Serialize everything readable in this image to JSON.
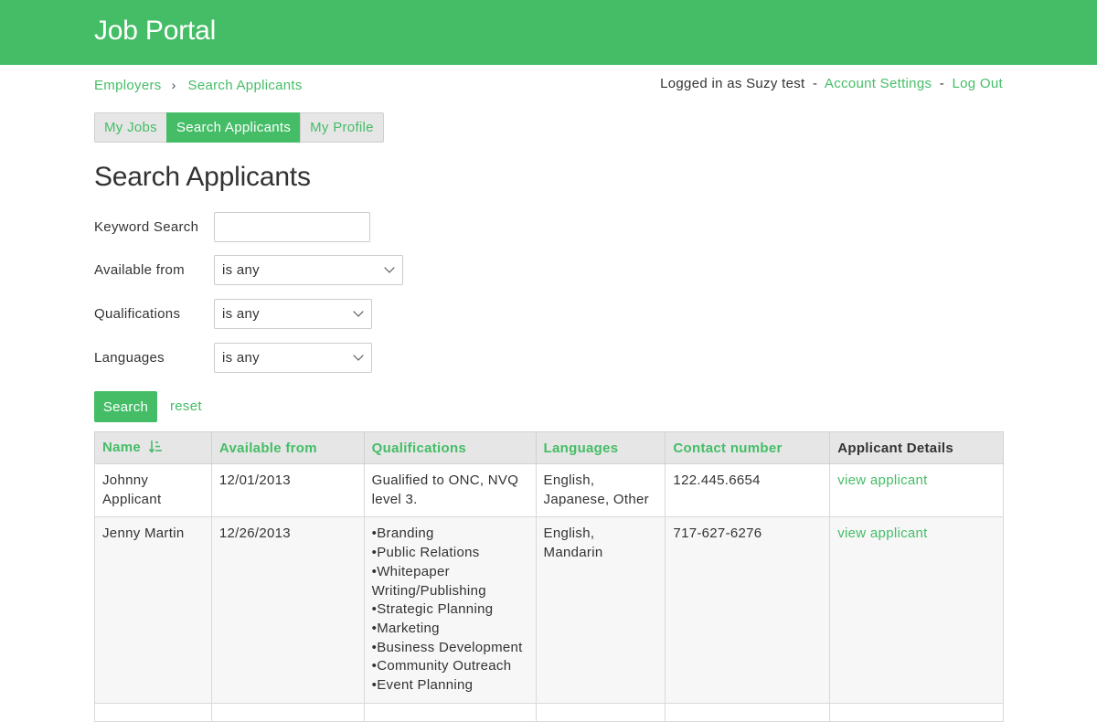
{
  "app": {
    "title": "Job Portal"
  },
  "breadcrumb": {
    "items": [
      "Employers",
      "Search Applicants"
    ],
    "separator": "›"
  },
  "account": {
    "logged_in_text": "Logged in as Suzy test",
    "dash": "-",
    "settings_label": "Account Settings",
    "logout_label": "Log Out"
  },
  "tabs": [
    {
      "label": "My Jobs",
      "active": false
    },
    {
      "label": "Search Applicants",
      "active": true
    },
    {
      "label": "My Profile",
      "active": false
    }
  ],
  "page": {
    "heading": "Search Applicants"
  },
  "filters": {
    "keyword": {
      "label": "Keyword Search",
      "value": "",
      "placeholder": ""
    },
    "available_from": {
      "label": "Available from",
      "selected": "is any"
    },
    "qualifications": {
      "label": "Qualifications",
      "selected": "is any"
    },
    "languages": {
      "label": "Languages",
      "selected": "is any"
    },
    "search_label": "Search",
    "reset_label": "reset"
  },
  "table": {
    "columns": [
      "Name",
      "Available from",
      "Qualifications",
      "Languages",
      "Contact number",
      "Applicant Details"
    ],
    "sort_icon": "sort-ascending-icon",
    "rows": [
      {
        "name": [
          "Johnny",
          "Applicant"
        ],
        "available_from": "12/01/2013",
        "qualifications": [
          "Gualified to ONC, NVQ",
          "level 3."
        ],
        "languages": [
          "English,",
          "Japanese, Other"
        ],
        "contact": "122.445.6654",
        "details_link": "view applicant"
      },
      {
        "name": [
          "Jenny Martin"
        ],
        "available_from": "12/26/2013",
        "qualifications": [
          "•Branding",
          "•Public Relations",
          "•Whitepaper",
          "Writing/Publishing",
          "•Strategic Planning",
          "•Marketing",
          "•Business Development",
          "•Community Outreach",
          "•Event Planning"
        ],
        "languages": [
          "English, Mandarin"
        ],
        "contact": "717-627-6276",
        "details_link": "view applicant"
      }
    ]
  },
  "colors": {
    "brand": "#45bd67",
    "header_bg": "#e6e6e6"
  }
}
